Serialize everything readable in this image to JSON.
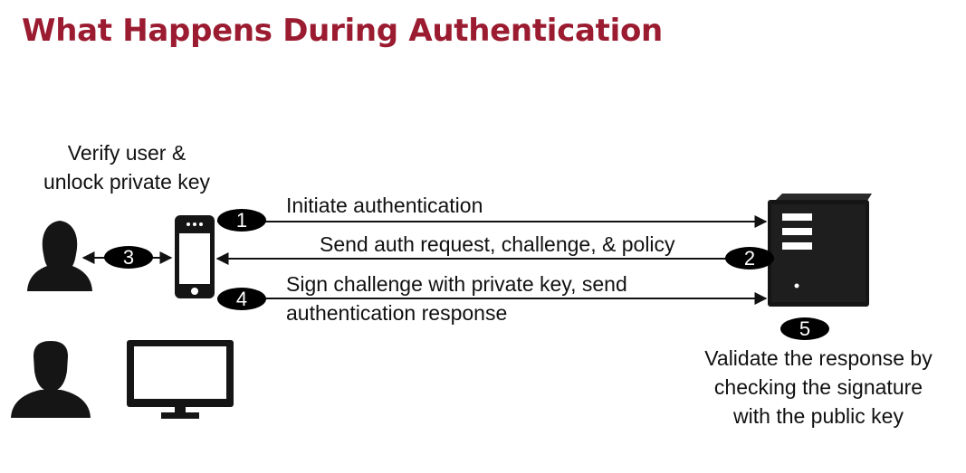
{
  "title": "What Happens During Authentication",
  "labels": {
    "verify": [
      "Verify user &",
      "unlock private key"
    ],
    "step1": "Initiate authentication",
    "step2": "Send auth request, challenge, & policy",
    "step4": [
      "Sign challenge with private key, send",
      "authentication response"
    ],
    "step5": [
      "Validate the response by",
      "checking the signature",
      "with the public key"
    ]
  },
  "badges": [
    "1",
    "2",
    "3",
    "4",
    "5"
  ],
  "icons": [
    "female-user-icon",
    "mobile-phone-icon",
    "server-icon",
    "male-user-icon",
    "desktop-monitor-icon"
  ],
  "colors": {
    "title": "#9b1b30",
    "ink": "#111111",
    "badge": "#000000"
  }
}
